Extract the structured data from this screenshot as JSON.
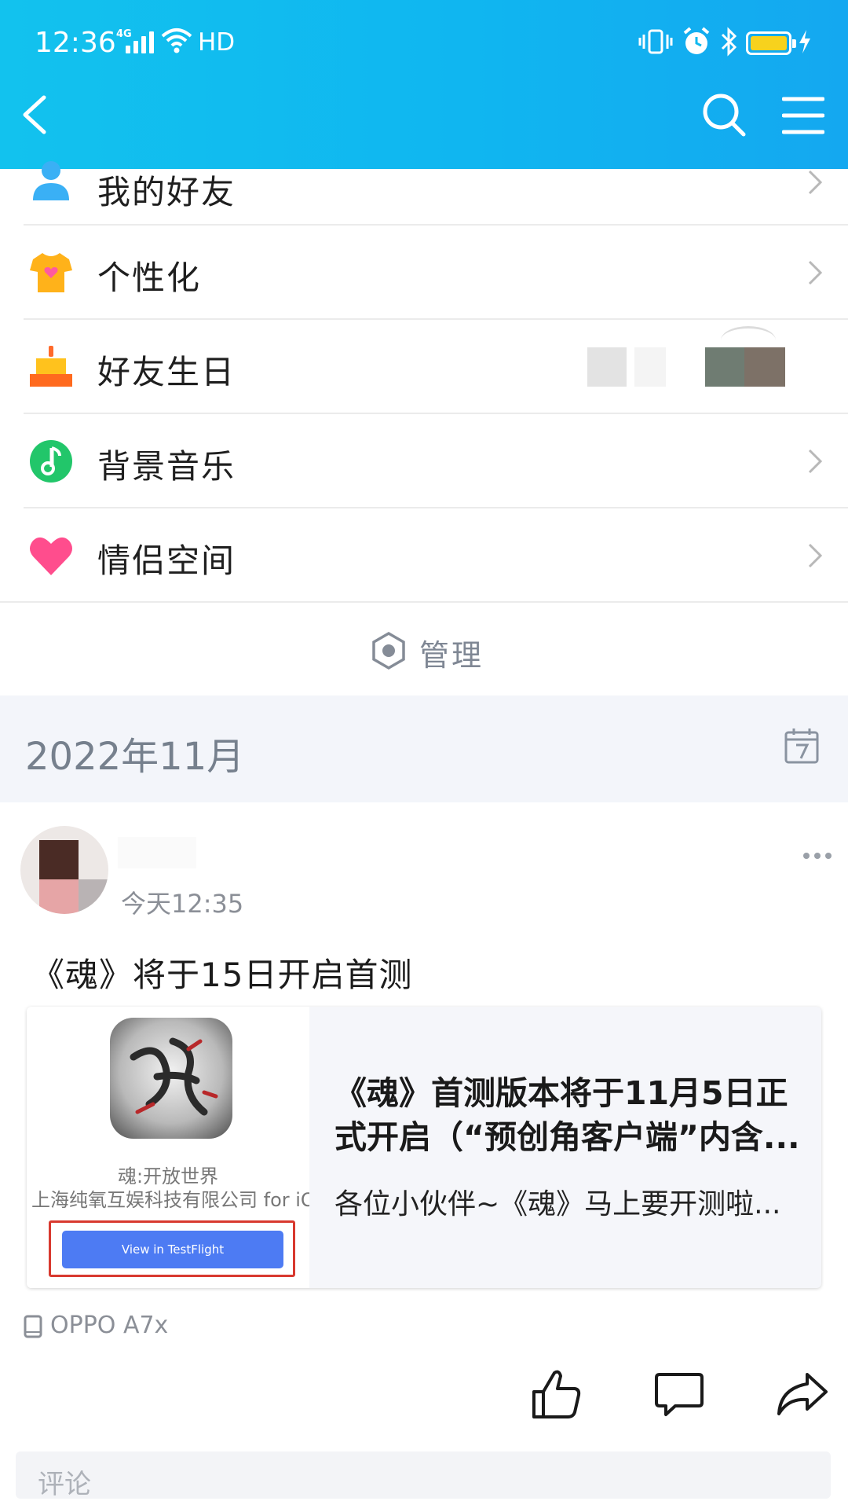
{
  "status_bar": {
    "time": "12:36",
    "network": "4G",
    "hd": "HD"
  },
  "settings_list": {
    "items": [
      {
        "label": "我的好友",
        "icon": "friends-icon"
      },
      {
        "label": "个性化",
        "icon": "tshirt-icon"
      },
      {
        "label": "好友生日",
        "icon": "cake-icon"
      },
      {
        "label": "背景音乐",
        "icon": "music-icon"
      },
      {
        "label": "情侣空间",
        "icon": "heart-icon"
      }
    ],
    "manage_label": "管理"
  },
  "timeline": {
    "month_label": "2022年11月"
  },
  "post": {
    "time": "今天12:35",
    "text": "《魂》将于15日开启首测",
    "card": {
      "thumb_app_name": "魂:开放世界",
      "thumb_company": "上海纯氧互娱科技有限公司 for iOS",
      "thumb_button": "View in TestFlight",
      "title": "《魂》首测版本将于11月5日正式开启（“预创角客户端”内含...",
      "description": "各位小伙伴~《魂》马上要开测啦..."
    },
    "device": "OPPO A7x",
    "comment_placeholder": "评论"
  },
  "colors": {
    "header_gradient_start": "#12c2ee",
    "header_gradient_end": "#14a8f0",
    "testflight_button": "#4d7bf3",
    "highlight_frame": "#d8392f",
    "battery": "#f7d21d"
  }
}
